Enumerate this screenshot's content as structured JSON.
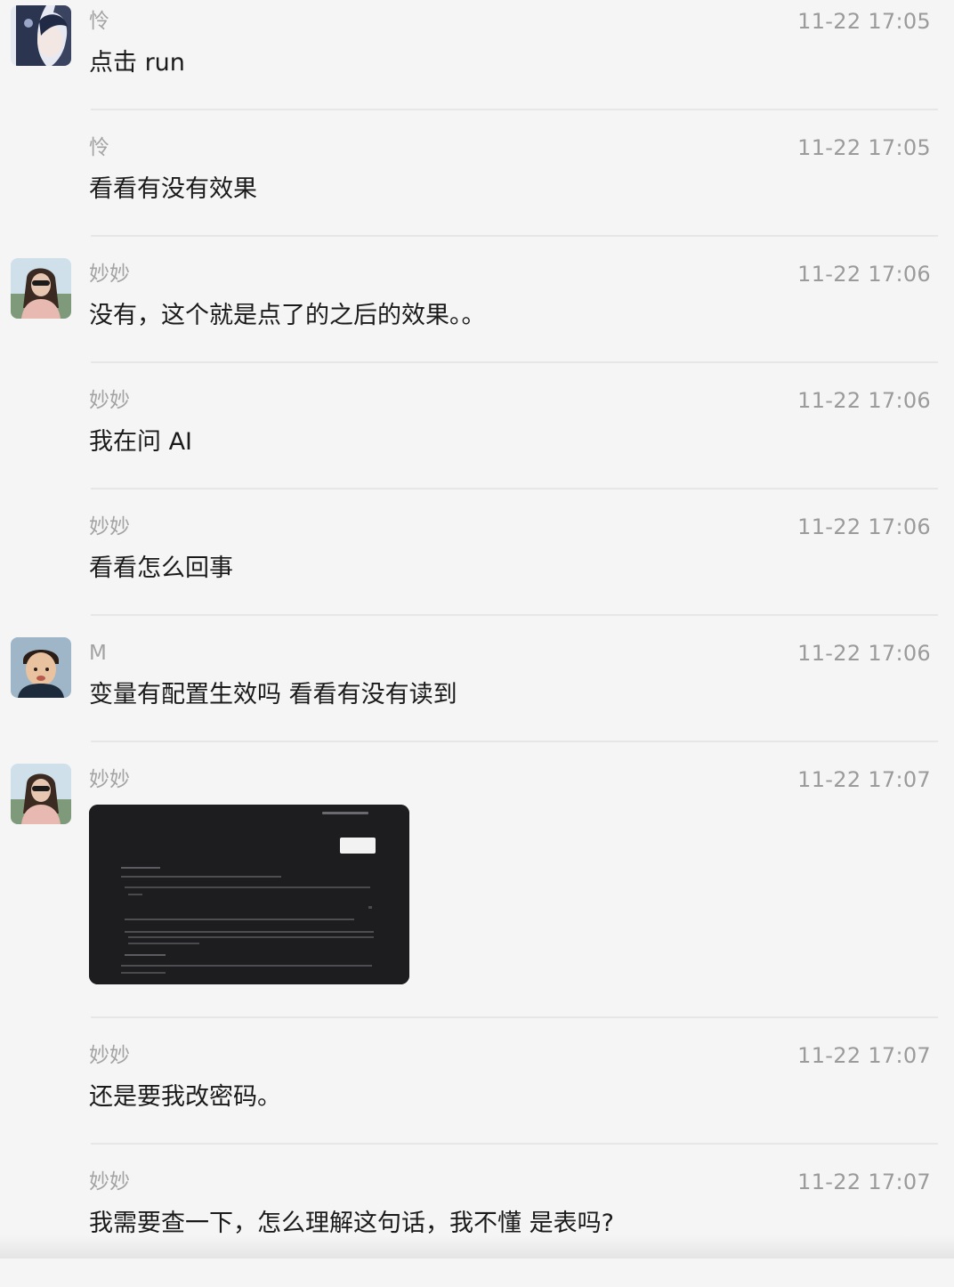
{
  "messages": [
    {
      "sender": "怜",
      "time": "11-22 17:05",
      "text": "点击 run",
      "avatar": "avatar-ling"
    },
    {
      "sender": "怜",
      "time": "11-22 17:05",
      "text": "看看有没有效果"
    },
    {
      "sender": "妙妙",
      "time": "11-22 17:06",
      "text": "没有，这个就是点了的之后的效果。。",
      "avatar": "avatar-miaomiao"
    },
    {
      "sender": "妙妙",
      "time": "11-22 17:06",
      "text": "我在问 AI"
    },
    {
      "sender": "妙妙",
      "time": "11-22 17:06",
      "text": "看看怎么回事"
    },
    {
      "sender": "M",
      "time": "11-22 17:06",
      "text": "变量有配置生效吗 看看有没有读到",
      "avatar": "avatar-m"
    },
    {
      "sender": "妙妙",
      "time": "11-22 17:07",
      "image": "screenshot-thumbnail",
      "avatar": "avatar-miaomiao"
    },
    {
      "sender": "妙妙",
      "time": "11-22 17:07",
      "text": "还是要我改密码。"
    },
    {
      "sender": "妙妙",
      "time": "11-22 17:07",
      "text": "我需要查一下，怎么理解这句话，我不懂 是表吗?"
    }
  ]
}
